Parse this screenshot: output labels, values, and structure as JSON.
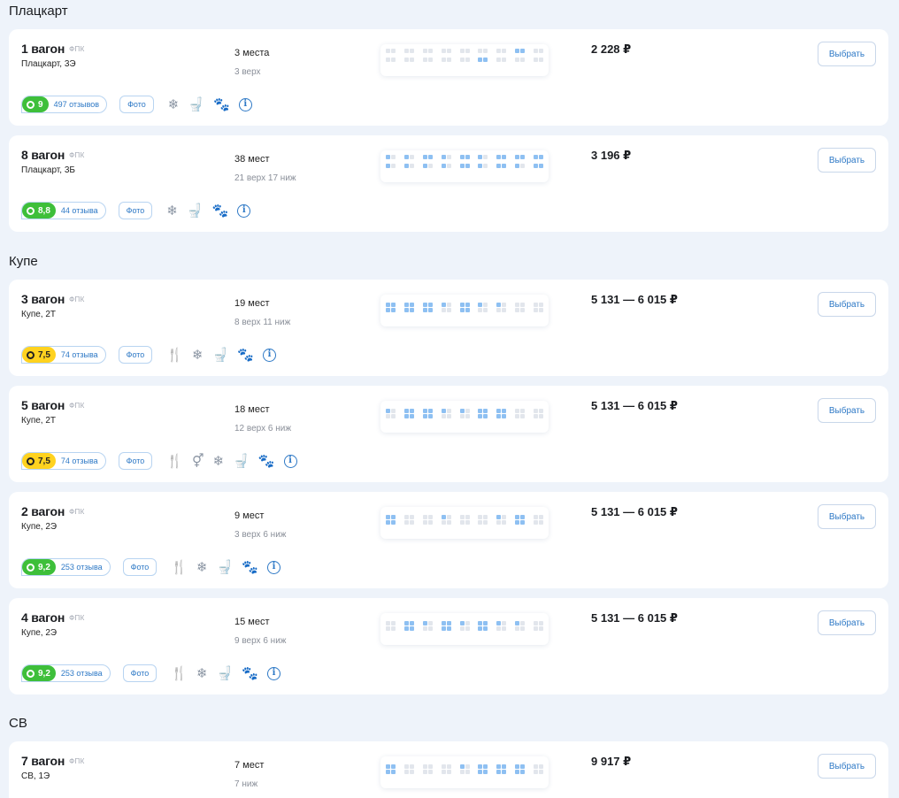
{
  "sections": [
    {
      "title": "Плацкарт",
      "wagons": [
        {
          "title": "1 вагон",
          "carrier": "ФПК",
          "class": "Плацкарт, 3Э",
          "seats_total": "3 места",
          "seats_detail": "3 верх",
          "price": "2 228 ₽",
          "rating": "9",
          "rating_color": "green",
          "reviews": "497 отзывов",
          "photo": "Фото",
          "amenities": [
            "snowflake-icon",
            "toilet-icon",
            "no-pets-icon",
            "info-icon"
          ]
        },
        {
          "title": "8 вагон",
          "carrier": "ФПК",
          "class": "Плацкарт, 3Б",
          "seats_total": "38 мест",
          "seats_detail": "21 верх 17 ниж",
          "price": "3 196 ₽",
          "rating": "8,8",
          "rating_color": "green",
          "reviews": "44 отзыва",
          "photo": "Фото",
          "amenities": [
            "snowflake-icon",
            "toilet-icon",
            "pets-icon",
            "info-icon"
          ]
        }
      ]
    },
    {
      "title": "Купе",
      "wagons": [
        {
          "title": "3 вагон",
          "carrier": "ФПК",
          "class": "Купе, 2Т",
          "seats_total": "19 мест",
          "seats_detail": "8 верх 11 ниж",
          "price": "5 131 — 6 015 ₽",
          "rating": "7,5",
          "rating_color": "yellow",
          "reviews": "74 отзыва",
          "photo": "Фото",
          "amenities": [
            "food-icon",
            "snowflake-icon",
            "toilet-icon",
            "no-pets-icon",
            "info-icon"
          ]
        },
        {
          "title": "5 вагон",
          "carrier": "ФПК",
          "class": "Купе, 2Т",
          "seats_total": "18 мест",
          "seats_detail": "12 верх 6 ниж",
          "price": "5 131 — 6 015 ₽",
          "rating": "7,5",
          "rating_color": "yellow",
          "reviews": "74 отзыва",
          "photo": "Фото",
          "amenities": [
            "food-icon",
            "gender-icon",
            "snowflake-icon",
            "toilet-icon",
            "no-pets-icon",
            "info-icon"
          ]
        },
        {
          "title": "2 вагон",
          "carrier": "ФПК",
          "class": "Купе, 2Э",
          "seats_total": "9 мест",
          "seats_detail": "3 верх 6 ниж",
          "price": "5 131 — 6 015 ₽",
          "rating": "9,2",
          "rating_color": "green",
          "reviews": "253 отзыва",
          "photo": "Фото",
          "amenities": [
            "food-icon",
            "snowflake-icon",
            "toilet-icon",
            "pets-icon",
            "info-icon"
          ]
        },
        {
          "title": "4 вагон",
          "carrier": "ФПК",
          "class": "Купе, 2Э",
          "seats_total": "15 мест",
          "seats_detail": "9 верх 6 ниж",
          "price": "5 131 — 6 015 ₽",
          "rating": "9,2",
          "rating_color": "green",
          "reviews": "253 отзыва",
          "photo": "Фото",
          "amenities": [
            "food-icon",
            "snowflake-icon",
            "toilet-icon",
            "pets-icon",
            "info-icon"
          ]
        }
      ]
    },
    {
      "title": "СВ",
      "wagons": [
        {
          "title": "7 вагон",
          "carrier": "ФПК",
          "class": "СВ, 1Э",
          "seats_total": "7 мест",
          "seats_detail": "7 ниж",
          "price": "9 917 ₽",
          "rating": "",
          "rating_color": "",
          "reviews": "",
          "photo": "",
          "amenities": []
        }
      ]
    }
  ],
  "select_label": "Выбрать",
  "colors": {
    "accent": "#2e79c6",
    "green": "#3ebf3a",
    "yellow": "#ffd21f",
    "background": "#eef3fa"
  }
}
